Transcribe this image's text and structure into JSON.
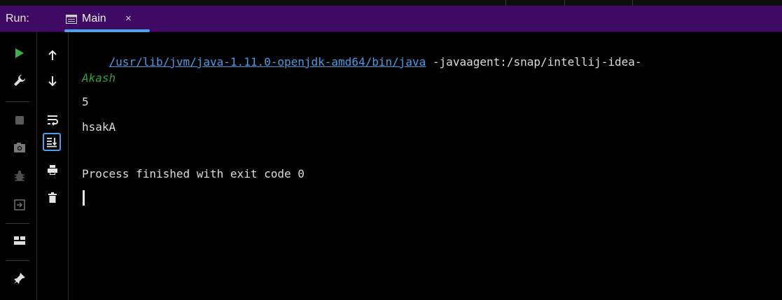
{
  "header": {
    "run_label": "Run:",
    "tab": {
      "label": "Main",
      "close": "×",
      "icon": "console-tab-icon"
    }
  },
  "toolbar_left": [
    {
      "name": "rerun-icon",
      "color": "#3fb04a"
    },
    {
      "name": "wrench-icon"
    },
    {
      "name": "stop-icon"
    },
    {
      "name": "camera-icon"
    },
    {
      "name": "bug-icon"
    },
    {
      "name": "exit-icon"
    },
    {
      "name": "layout-icon"
    },
    {
      "name": "pin-icon"
    }
  ],
  "toolbar_right": [
    {
      "name": "up-arrow-icon"
    },
    {
      "name": "down-arrow-icon"
    },
    {
      "name": "soft-wrap-icon"
    },
    {
      "name": "scroll-to-end-icon"
    },
    {
      "name": "print-icon"
    },
    {
      "name": "trash-icon"
    }
  ],
  "console": {
    "command_path": "/usr/lib/jvm/java-1.11.0-openjdk-amd64/bin/java",
    "command_args": " -javaagent:/snap/intellij-idea-",
    "input_echo": "Akash",
    "output_lines": [
      "5",
      "hsakA"
    ],
    "finish_message": "Process finished with exit code 0"
  },
  "colors": {
    "header_bg": "#3e0a63",
    "link": "#4a9be6",
    "input_green": "#3a9c3a",
    "run_green": "#3fb04a",
    "tab_underline": "#4fa3e6"
  }
}
